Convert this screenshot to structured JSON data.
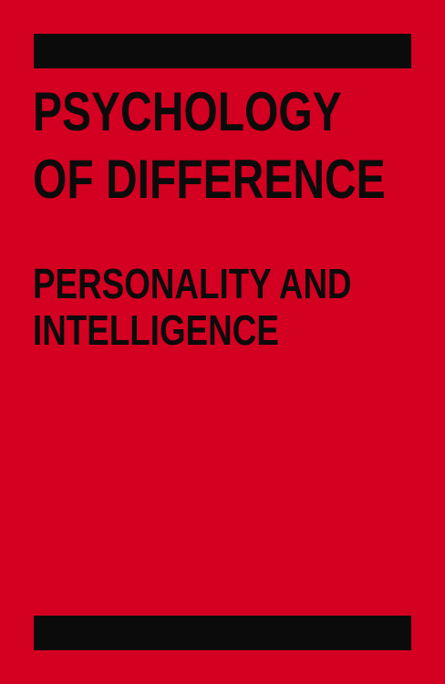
{
  "cover": {
    "background_color": "#d40022",
    "bar_color": "#0b0b0b",
    "title_lines": [
      "PSYCHOLOGY",
      "OF DIFFERENCE"
    ],
    "subtitle_lines": [
      "PERSONALITY AND",
      "INTELLIGENCE"
    ]
  }
}
